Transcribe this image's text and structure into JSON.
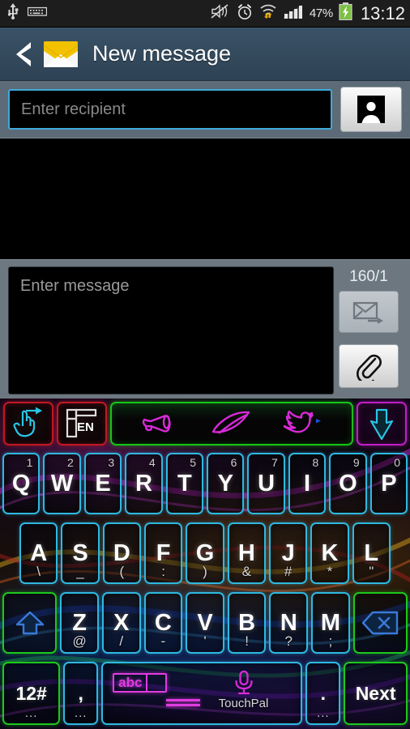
{
  "statusbar": {
    "icons_left": [
      "usb-icon",
      "keyboard-icon"
    ],
    "icons_right": [
      "mute-icon",
      "alarm-icon",
      "wifi-icon",
      "signal-icon"
    ],
    "battery_percent": "47%",
    "battery_state": "charging",
    "clock": "13:12"
  },
  "appbar": {
    "back_label": "‹",
    "icon": "envelope-icon",
    "title": "New message"
  },
  "recipient": {
    "placeholder": "Enter recipient",
    "value": "",
    "contacts_icon": "person-icon"
  },
  "composer": {
    "placeholder": "Enter message",
    "value": "",
    "counter": "160/1",
    "send_icon": "send-message-icon",
    "attach_icon": "paperclip-icon"
  },
  "keyboard": {
    "name": "TouchPal",
    "toolbar": {
      "swipe_key": "swipe-gesture-icon",
      "layout_key_label": "EN",
      "strip_icons": [
        "megaphone-icon",
        "pen-icon",
        "twitter-bird-icon"
      ],
      "hide_key": "down-arrow-icon"
    },
    "row1": [
      {
        "label": "Q",
        "num": "1"
      },
      {
        "label": "W",
        "num": "2"
      },
      {
        "label": "E",
        "num": "3"
      },
      {
        "label": "R",
        "num": "4"
      },
      {
        "label": "T",
        "num": "5"
      },
      {
        "label": "Y",
        "num": "6"
      },
      {
        "label": "U",
        "num": "7"
      },
      {
        "label": "I",
        "num": "8"
      },
      {
        "label": "O",
        "num": "9"
      },
      {
        "label": "P",
        "num": "0"
      }
    ],
    "row2": [
      {
        "label": "A",
        "alt": "\\"
      },
      {
        "label": "S",
        "alt": "_"
      },
      {
        "label": "D",
        "alt": "("
      },
      {
        "label": "F",
        "alt": ":"
      },
      {
        "label": "G",
        "alt": ")"
      },
      {
        "label": "H",
        "alt": "&"
      },
      {
        "label": "J",
        "alt": "#"
      },
      {
        "label": "K",
        "alt": "*"
      },
      {
        "label": "L",
        "alt": "\""
      }
    ],
    "row3": {
      "shift": "shift-arrow-icon",
      "keys": [
        {
          "label": "Z",
          "alt": "@"
        },
        {
          "label": "X",
          "alt": "/"
        },
        {
          "label": "C",
          "alt": "-"
        },
        {
          "label": "V",
          "alt": "'"
        },
        {
          "label": "B",
          "alt": "!"
        },
        {
          "label": "N",
          "alt": "?"
        },
        {
          "label": "M",
          "alt": ";"
        }
      ],
      "backspace": "backspace-icon"
    },
    "row4": {
      "symbols_label": "12#",
      "comma_label": ",",
      "comma_dots": "...",
      "space_abc": "abc",
      "space_mic": "microphone-icon",
      "space_brand": "TouchPal",
      "period_label": ".",
      "period_dots": "...",
      "next_label": "Next",
      "symbols_dots": "..."
    }
  },
  "colors": {
    "appbar": "#33495c",
    "panel": "#6d7780",
    "accent_cyan": "#2fb8e0",
    "accent_green": "#1dc81d",
    "accent_red": "#c01824",
    "accent_magenta": "#c21ec8",
    "battery_green": "#7bc043"
  }
}
